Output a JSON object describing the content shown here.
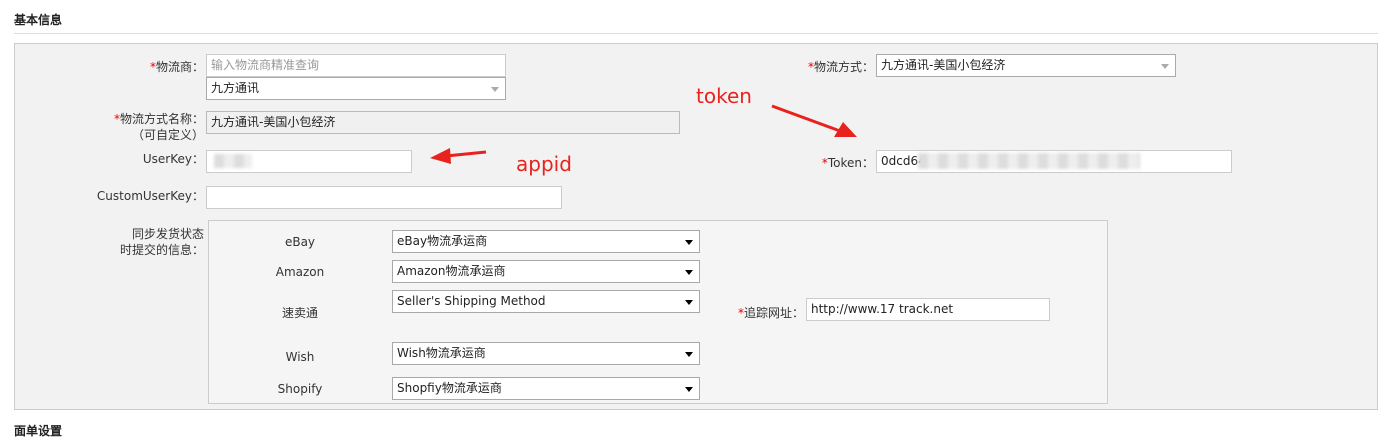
{
  "sections": {
    "basic_info": "基本信息",
    "form_settings": "面单设置"
  },
  "required_mark": "*",
  "logistics_provider": {
    "label": "物流商：",
    "search_placeholder": "输入物流商精准查询",
    "selected": "九方通讯"
  },
  "shipping_method": {
    "label": "物流方式：",
    "selected": "九方通讯-美国小包经济"
  },
  "method_name": {
    "label_line1": "物流方式名称：",
    "label_line2": "（可自定义）",
    "value": "九方通讯-美国小包经济"
  },
  "userkey": {
    "label": "UserKey：",
    "value": ""
  },
  "token": {
    "label": "Token：",
    "value_visible": "0dcd64"
  },
  "custom_userkey": {
    "label": "CustomUserKey：",
    "value": ""
  },
  "sync": {
    "label_line1": "同步发货状态",
    "label_line2": "时提交的信息：",
    "rows": [
      {
        "platform": "eBay",
        "value": "eBay物流承运商"
      },
      {
        "platform": "Amazon",
        "value": "Amazon物流承运商"
      },
      {
        "platform": "速卖通",
        "value": "Seller's Shipping Method"
      },
      {
        "platform": "Wish",
        "value": "Wish物流承运商"
      },
      {
        "platform": "Shopify",
        "value": "Shopfiy物流承运商"
      }
    ],
    "tracking_label": "追踪网址：",
    "tracking_value": "http://www.17 track.net"
  },
  "annotations": {
    "token": "token",
    "appid": "appid",
    "color": "#e8231e"
  }
}
